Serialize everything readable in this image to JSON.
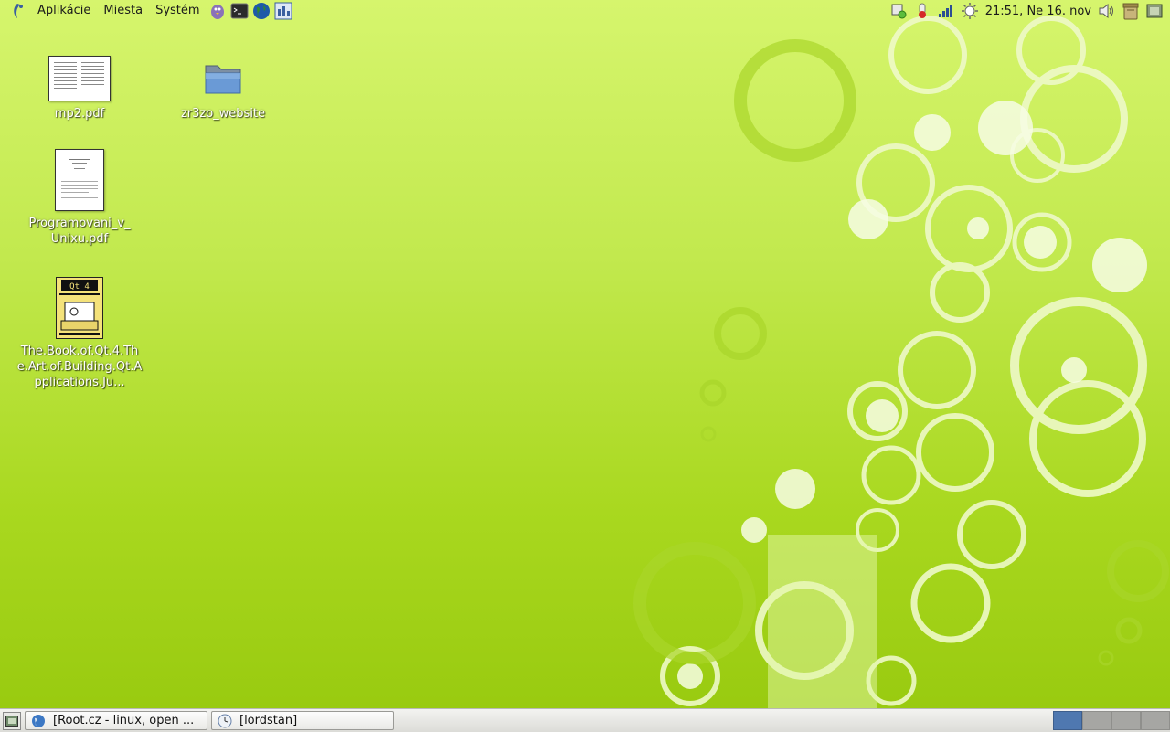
{
  "top_panel": {
    "menus": [
      "Aplikácie",
      "Miesta",
      "Systém"
    ],
    "launchers": [
      "pidgin-icon",
      "terminal-icon",
      "web-browser-icon",
      "network-monitor-icon"
    ],
    "tray_icons": [
      "network-manager-icon",
      "system-monitor-icon",
      "signal-strength-icon",
      "weather-icon"
    ],
    "clock": "21:51, Ne 16. nov",
    "right_icons": [
      "volume-icon",
      "trash-icon",
      "window-switch-icon"
    ]
  },
  "desktop": {
    "icons": [
      {
        "label": "mp2.pdf",
        "type": "pdf"
      },
      {
        "label": "zr3zo_website",
        "type": "folder"
      },
      {
        "label": "Programovani_v_Unixu.pdf",
        "type": "pdf"
      },
      {
        "label": "The.Book.of.Qt.4.The.Art.of.Building.Qt.Applications.Ju...",
        "type": "pdf-cover"
      }
    ]
  },
  "bottom_panel": {
    "tasks": [
      {
        "label": "[Root.cz - linux, open ...",
        "icon": "web-browser-icon"
      },
      {
        "label": "[lordstan]",
        "icon": "clock-icon"
      }
    ],
    "workspaces": [
      true,
      false,
      false,
      false
    ]
  },
  "colors": {
    "wallpaper_light": "#d6f56d",
    "wallpaper_dark": "#97c90e",
    "workspace_active": "#4f78b0"
  }
}
